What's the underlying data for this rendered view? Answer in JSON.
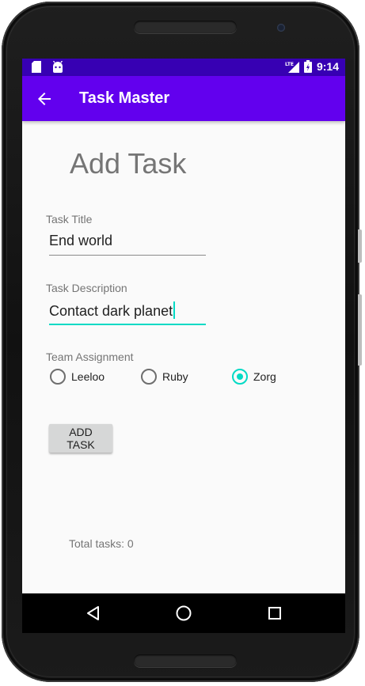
{
  "status_bar": {
    "time": "9:14",
    "icons": [
      "sd-card-icon",
      "android-icon",
      "lte-signal-icon",
      "battery-charging-icon"
    ],
    "color": "#3700b3"
  },
  "app_bar": {
    "title": "Task Master",
    "back_icon": "arrow-back-icon",
    "color": "#6200ee"
  },
  "form": {
    "heading": "Add Task",
    "title_label": "Task Title",
    "title_value": "End world",
    "description_label": "Task Description",
    "description_value": "Contact dark planet",
    "team_label": "Team Assignment",
    "teams": [
      {
        "label": "Leeloo",
        "checked": false
      },
      {
        "label": "Ruby",
        "checked": false
      },
      {
        "label": "Zorg",
        "checked": true
      }
    ],
    "add_button": "ADD TASK",
    "accent_color": "#03dac5"
  },
  "footer": {
    "total_tasks": "Total tasks: 0"
  },
  "nav_bar": {
    "buttons": [
      "back-triangle-icon",
      "home-circle-icon",
      "recents-square-icon"
    ]
  }
}
